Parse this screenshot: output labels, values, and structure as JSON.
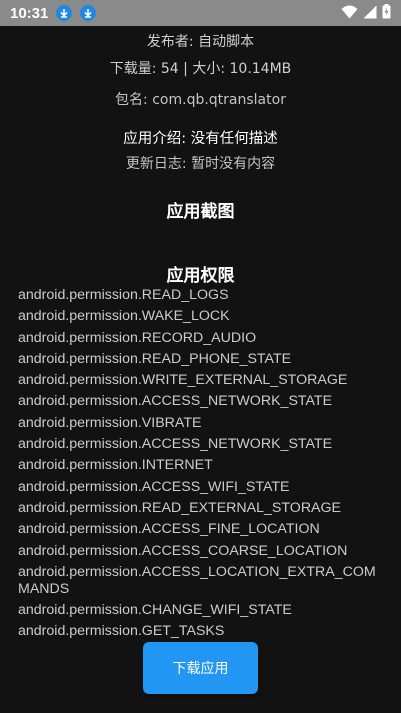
{
  "status_bar": {
    "time": "10:31",
    "icons": [
      "download-icon",
      "download-icon",
      "wifi-icon",
      "signal-icon",
      "battery-charging-icon"
    ]
  },
  "info": {
    "publisher": "发布者: 自动脚本",
    "stats": "下载量: 54 | 大小: 10.14MB",
    "package": "包名: com.qb.qtranslator",
    "description": "应用介绍: 没有任何描述",
    "changelog": "更新日志: 暂时没有内容"
  },
  "sections": {
    "screenshots_title": "应用截图",
    "permissions_title": "应用权限"
  },
  "permissions": [
    "android.permission.READ_LOGS",
    "android.permission.WAKE_LOCK",
    "android.permission.RECORD_AUDIO",
    "android.permission.READ_PHONE_STATE",
    "android.permission.WRITE_EXTERNAL_STORAGE",
    "android.permission.ACCESS_NETWORK_STATE",
    "android.permission.VIBRATE",
    "android.permission.ACCESS_NETWORK_STATE",
    "android.permission.INTERNET",
    "android.permission.ACCESS_WIFI_STATE",
    "android.permission.READ_EXTERNAL_STORAGE",
    "android.permission.ACCESS_FINE_LOCATION",
    "android.permission.ACCESS_COARSE_LOCATION",
    "android.permission.ACCESS_LOCATION_EXTRA_COMMANDS",
    "android.permission.CHANGE_WIFI_STATE",
    "android.permission.GET_TASKS"
  ],
  "actions": {
    "download_label": "下载应用"
  },
  "colors": {
    "background": "#121212",
    "status_bar": "#8a8a8a",
    "accent": "#2196f3"
  }
}
